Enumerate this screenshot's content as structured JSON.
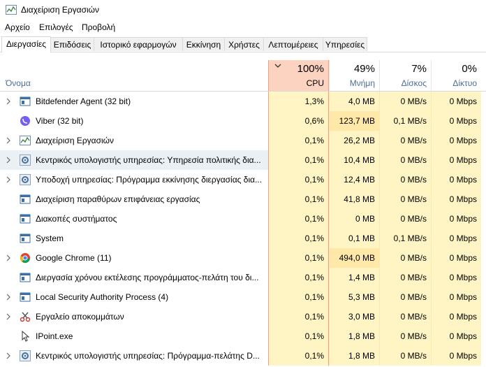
{
  "window": {
    "title": "Διαχείριση Εργασιών"
  },
  "menu": [
    "Αρχείο",
    "Επιλογές",
    "Προβολή"
  ],
  "tabs": [
    "Διεργασίες",
    "Επιδόσεις",
    "Ιστορικό εφαρμογών",
    "Εκκίνηση",
    "Χρήστες",
    "Λεπτομέρειες",
    "Υπηρεσίες"
  ],
  "columns": {
    "name": "Όνομα",
    "cpu": {
      "pct": "100%",
      "label": "CPU"
    },
    "memory": {
      "pct": "49%",
      "label": "Μνήμη"
    },
    "disk": {
      "pct": "7%",
      "label": "Δίσκος"
    },
    "network": {
      "pct": "0%",
      "label": "Δίκτυο"
    }
  },
  "processes": [
    {
      "name": "Bitdefender Agent (32 bit)",
      "cpu": "1,3%",
      "memory": "4,0 MB",
      "disk": "0 MB/s",
      "network": "0 Mbps",
      "icon": "app-window-icon",
      "expandable": true
    },
    {
      "name": "Viber (32 bit)",
      "cpu": "0,6%",
      "memory": "123,7 MB",
      "disk": "0,1 MB/s",
      "network": "0 Mbps",
      "icon": "viber-icon",
      "expandable": false
    },
    {
      "name": "Διαχείριση Εργασιών",
      "cpu": "0,1%",
      "memory": "26,2 MB",
      "disk": "0 MB/s",
      "network": "0 Mbps",
      "icon": "task-manager-icon",
      "expandable": true
    },
    {
      "name": "Κεντρικός υπολογιστής υπηρεσίας: Υπηρεσία πολιτικής δια...",
      "cpu": "0,1%",
      "memory": "10,4 MB",
      "disk": "0 MB/s",
      "network": "0 Mbps",
      "icon": "gear-icon",
      "expandable": true
    },
    {
      "name": "Υποδοχή υπηρεσίας: Πρόγραμμα εκκίνησης διεργασίας δια...",
      "cpu": "0,1%",
      "memory": "12,4 MB",
      "disk": "0 MB/s",
      "network": "0 Mbps",
      "icon": "gear-icon",
      "expandable": true
    },
    {
      "name": "Διαχείριση παραθύρων επιφάνειας εργασίας",
      "cpu": "0,1%",
      "memory": "41,8 MB",
      "disk": "0 MB/s",
      "network": "0 Mbps",
      "icon": "app-window-icon",
      "expandable": false
    },
    {
      "name": "Διακοπές συστήματος",
      "cpu": "0,1%",
      "memory": "0 MB",
      "disk": "0 MB/s",
      "network": "0 Mbps",
      "icon": "app-window-icon",
      "expandable": false
    },
    {
      "name": "System",
      "cpu": "0,1%",
      "memory": "0,1 MB",
      "disk": "0,1 MB/s",
      "network": "0 Mbps",
      "icon": "app-window-icon",
      "expandable": false
    },
    {
      "name": "Google Chrome (11)",
      "cpu": "0,1%",
      "memory": "494,0 MB",
      "disk": "0 MB/s",
      "network": "0 Mbps",
      "icon": "chrome-icon",
      "expandable": true
    },
    {
      "name": "Διεργασία χρόνου εκτέλεσης προγράμματος-πελάτη του δι...",
      "cpu": "0,1%",
      "memory": "1,4 MB",
      "disk": "0 MB/s",
      "network": "0 Mbps",
      "icon": "app-window-icon",
      "expandable": false
    },
    {
      "name": "Local Security Authority Process (4)",
      "cpu": "0,1%",
      "memory": "5,3 MB",
      "disk": "0 MB/s",
      "network": "0 Mbps",
      "icon": "app-window-icon",
      "expandable": true
    },
    {
      "name": "Εργαλείο αποκομμάτων",
      "cpu": "0,1%",
      "memory": "3,0 MB",
      "disk": "0 MB/s",
      "network": "0 Mbps",
      "icon": "scissors-icon",
      "expandable": true
    },
    {
      "name": "IPoint.exe",
      "cpu": "0,1%",
      "memory": "1,8 MB",
      "disk": "0 MB/s",
      "network": "0 Mbps",
      "icon": "pointer-icon",
      "expandable": false
    },
    {
      "name": "Κεντρικός υπολογιστής υπηρεσίας: Πρόγραμμα-πελάτης D...",
      "cpu": "0,1%",
      "memory": "1,8 MB",
      "disk": "0 MB/s",
      "network": "0 Mbps",
      "icon": "gear-icon",
      "expandable": true
    }
  ],
  "highlighted_row": 3,
  "colors": {
    "cpu_header": "#fcd3c1",
    "cell": "#fff4c4",
    "cell_high": "#ffe8a8",
    "header_text": "#4c6e96"
  }
}
